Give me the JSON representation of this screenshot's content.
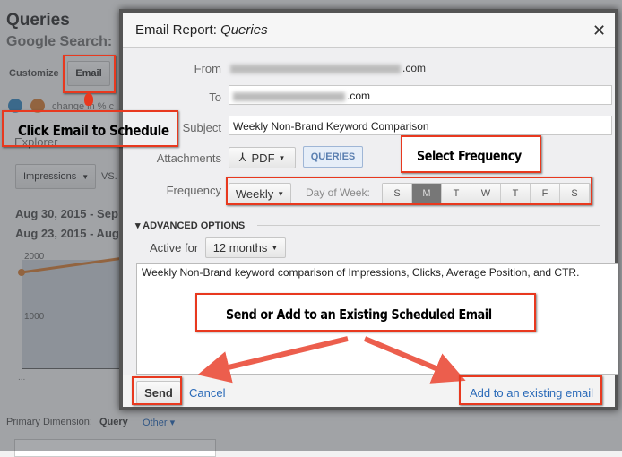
{
  "page": {
    "title": "Queries",
    "subtitle": "Google Search: ",
    "customize": "Customize",
    "email": "Email",
    "change_text": "change in % c",
    "explorer": "Explorer",
    "metric": "Impressions",
    "vs": "VS.",
    "date1": "Aug 30, 2015 - Sep",
    "date2": "Aug 23, 2015 - Aug",
    "y2000": "2000",
    "y1000": "1000",
    "ellipsis": "...",
    "primary_dim_label": "Primary Dimension:",
    "primary_dim_value": "Query",
    "other": "Other"
  },
  "dialog": {
    "title_prefix": "Email Report: ",
    "title_name": "Queries",
    "close": "✕",
    "from_label": "From",
    "from_suffix": ".com",
    "to_label": "To",
    "to_suffix": ".com",
    "subject_label": "Subject",
    "subject_value": "Weekly Non-Brand Keyword Comparison",
    "attachments_label": "Attachments",
    "pdf": "PDF",
    "queries": "QUERIES",
    "frequency_label": "Frequency",
    "frequency_value": "Weekly",
    "dow_label": "Day of Week:",
    "days": [
      "S",
      "M",
      "T",
      "W",
      "T",
      "F",
      "S"
    ],
    "selected_day": "M",
    "advanced": "ADVANCED OPTIONS",
    "active_label": "Active for",
    "active_value": "12 months",
    "message": "Weekly Non-Brand keyword comparison of Impressions, Clicks, Average Position, and CTR.",
    "send": "Send",
    "cancel": "Cancel",
    "add_existing": "Add to an existing email"
  },
  "annotations": {
    "click_email": "Click Email to Schedule",
    "select_frequency": "Select Frequency",
    "send_or_add": "Send or Add to an Existing Scheduled Email"
  },
  "colors": {
    "annotation": "#e8391f",
    "link": "#2a6ab8"
  }
}
